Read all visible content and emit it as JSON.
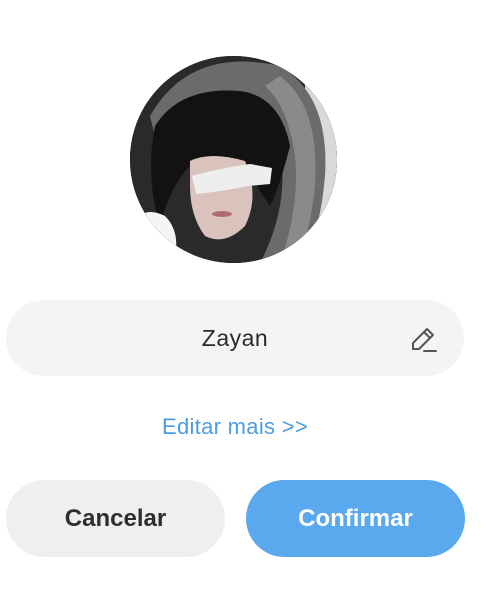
{
  "profile": {
    "avatar_alt": "profile-photo",
    "name": "Zayan",
    "edit_icon": "pencil-icon"
  },
  "links": {
    "more": "Editar mais >>"
  },
  "actions": {
    "cancel_label": "Cancelar",
    "confirm_label": "Confirmar"
  },
  "colors": {
    "accent": "#5aa8ee",
    "link": "#4d9ee0",
    "field_bg": "#f4f4f4",
    "cancel_bg": "#efefef"
  }
}
